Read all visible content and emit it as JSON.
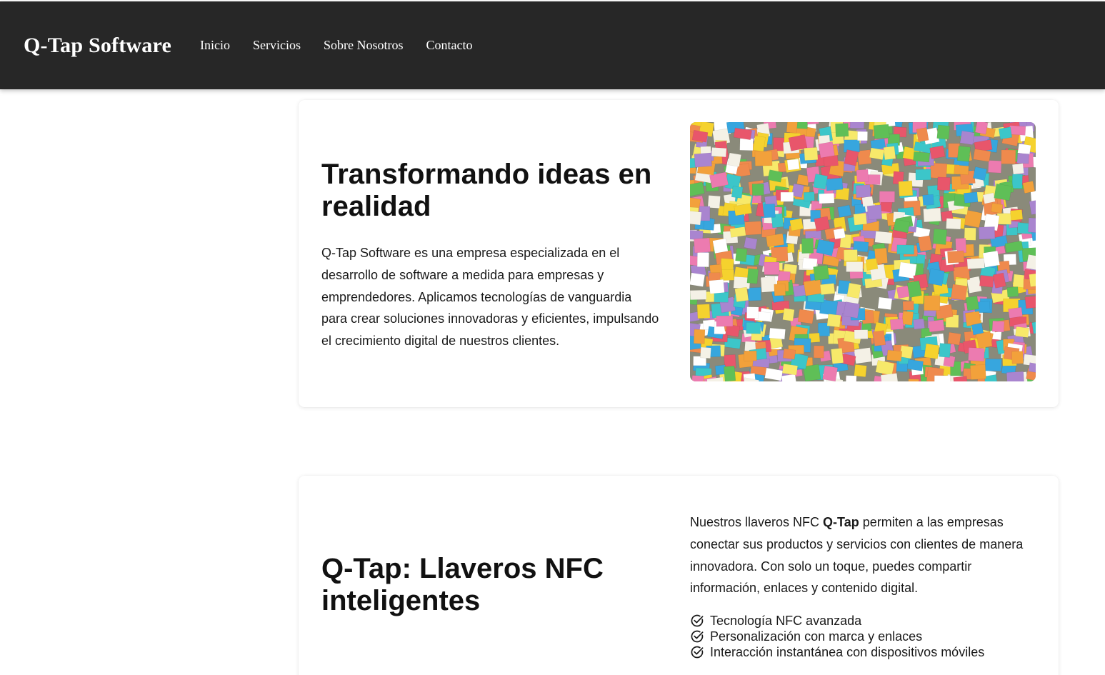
{
  "header": {
    "brand": "Q-Tap Software",
    "nav": [
      {
        "label": "Inicio"
      },
      {
        "label": "Servicios"
      },
      {
        "label": "Sobre Nosotros"
      },
      {
        "label": "Contacto"
      }
    ]
  },
  "hero": {
    "title": "Transformando ideas en realidad",
    "description": "Q-Tap Software es una empresa especializada en el desarrollo de software a medida para empresas y emprendedores. Aplicamos tecnologías de vanguardia para crear soluciones innovadoras y eficientes, impulsando el crecimiento digital de nuestros clientes.",
    "image_icon": "sticky-notes-wall-image"
  },
  "product": {
    "title": "Q-Tap: Llaveros NFC inteligentes",
    "desc_pre": "Nuestros llaveros NFC ",
    "desc_bold": "Q-Tap",
    "desc_post": " permiten a las empresas conectar sus productos y servicios con clientes de manera innovadora. Con solo un toque, puedes compartir información, enlaces y contenido digital.",
    "features": [
      {
        "label": "Tecnología NFC avanzada",
        "icon": "check-circle-icon"
      },
      {
        "label": "Personalización con marca y enlaces",
        "icon": "check-circle-icon"
      },
      {
        "label": "Interacción instantánea con dispositivos móviles",
        "icon": "check-circle-icon"
      }
    ]
  },
  "colors": {
    "navbar_bg": "#272727",
    "nav_text": "#ffffff",
    "page_bg": "#ffffff"
  }
}
